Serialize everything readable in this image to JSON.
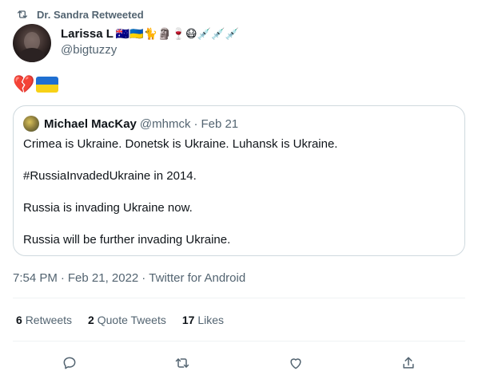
{
  "retweet_bar": {
    "label": "Dr. Sandra Retweeted",
    "icon": "retweet-icon"
  },
  "author": {
    "display_name": "Larissa L",
    "name_emojis": "🇦🇺🇺🇦🐈🗿🍷😷💉💉💉",
    "handle": "@bigtuzzy"
  },
  "tweet": {
    "emojis": "💔",
    "flag_colors": {
      "blue": "#1f6fd1",
      "yellow": "#f7d117"
    }
  },
  "quote": {
    "name": "Michael MacKay",
    "handle": "@mhmck",
    "dot": "·",
    "date": "Feb 21",
    "lines": [
      "Crimea is Ukraine. Donetsk is Ukraine. Luhansk is Ukraine.",
      "#RussiaInvadedUkraine in 2014.",
      "Russia is invading Ukraine now.",
      "Russia will be further invading Ukraine."
    ]
  },
  "meta": {
    "time": "7:54 PM",
    "dot1": "·",
    "date": "Feb 21, 2022",
    "dot2": "·",
    "source": "Twitter for Android"
  },
  "stats": [
    {
      "count": "6",
      "label": "Retweets"
    },
    {
      "count": "2",
      "label": "Quote Tweets"
    },
    {
      "count": "17",
      "label": "Likes"
    }
  ],
  "colors": {
    "text": "#0f1419",
    "secondary": "#536471",
    "border": "#cfd9de",
    "divider": "#eff3f4"
  },
  "actions": [
    "reply-icon",
    "retweet-icon",
    "like-icon",
    "share-icon"
  ]
}
